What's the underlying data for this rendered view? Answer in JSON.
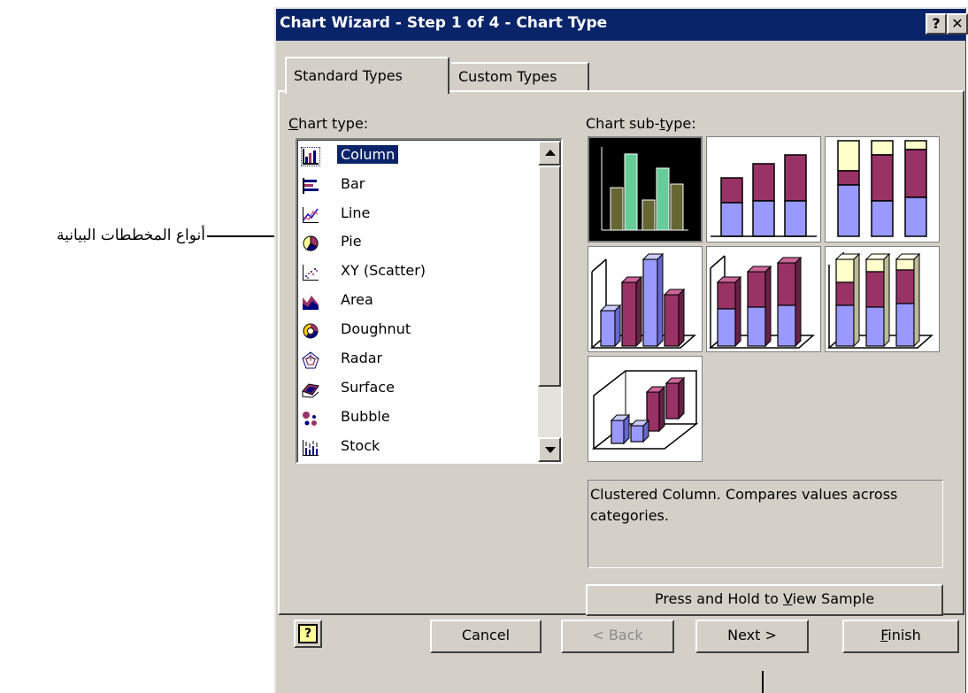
{
  "annotation": {
    "text": "أنواع المخططات البيانية"
  },
  "window": {
    "title": "Chart Wizard - Step 1 of 4 - Chart Type",
    "help_label": "?",
    "close_label": "✕"
  },
  "tabs": [
    {
      "label": "Standard Types"
    },
    {
      "label": "Custom Types"
    }
  ],
  "chart_type": {
    "label_first": "C",
    "label_rest": "hart type:",
    "selected": "Column",
    "items": [
      {
        "label": "Column",
        "icon": "column-chart-icon"
      },
      {
        "label": "Bar",
        "icon": "bar-chart-icon"
      },
      {
        "label": "Line",
        "icon": "line-chart-icon"
      },
      {
        "label": "Pie",
        "icon": "pie-chart-icon"
      },
      {
        "label": "XY (Scatter)",
        "icon": "scatter-chart-icon"
      },
      {
        "label": "Area",
        "icon": "area-chart-icon"
      },
      {
        "label": "Doughnut",
        "icon": "doughnut-chart-icon"
      },
      {
        "label": "Radar",
        "icon": "radar-chart-icon"
      },
      {
        "label": "Surface",
        "icon": "surface-chart-icon"
      },
      {
        "label": "Bubble",
        "icon": "bubble-chart-icon"
      },
      {
        "label": "Stock",
        "icon": "stock-chart-icon"
      }
    ]
  },
  "sub_type": {
    "label_pre": "Chart sub-",
    "label_u": "t",
    "label_post": "ype:",
    "items": [
      {
        "icon": "clustered-column-icon",
        "selected": true
      },
      {
        "icon": "stacked-column-icon",
        "selected": false
      },
      {
        "icon": "100-stacked-column-icon",
        "selected": false
      },
      {
        "icon": "3d-clustered-column-icon",
        "selected": false
      },
      {
        "icon": "3d-stacked-column-icon",
        "selected": false
      },
      {
        "icon": "3d-100-stacked-column-icon",
        "selected": false
      },
      {
        "icon": "3d-column-icon",
        "selected": false
      }
    ],
    "description": "Clustered Column. Compares values across categories."
  },
  "buttons": {
    "view_sample_pre": "Press and Hold to ",
    "view_sample_u": "V",
    "view_sample_post": "iew Sample",
    "help_icon": "?",
    "cancel": "Cancel",
    "back": "< Back",
    "next": "Next >",
    "finish_u": "F",
    "finish_rest": "inish"
  },
  "colors": {
    "title_bar": "#0a246a",
    "dialog_face": "#d4d0c8",
    "selection": "#0a246a",
    "series_periwinkle": "#9999ff",
    "series_plum": "#993366",
    "series_cream": "#ffffcc",
    "series_green": "#66cc99",
    "series_olive": "#666633"
  }
}
